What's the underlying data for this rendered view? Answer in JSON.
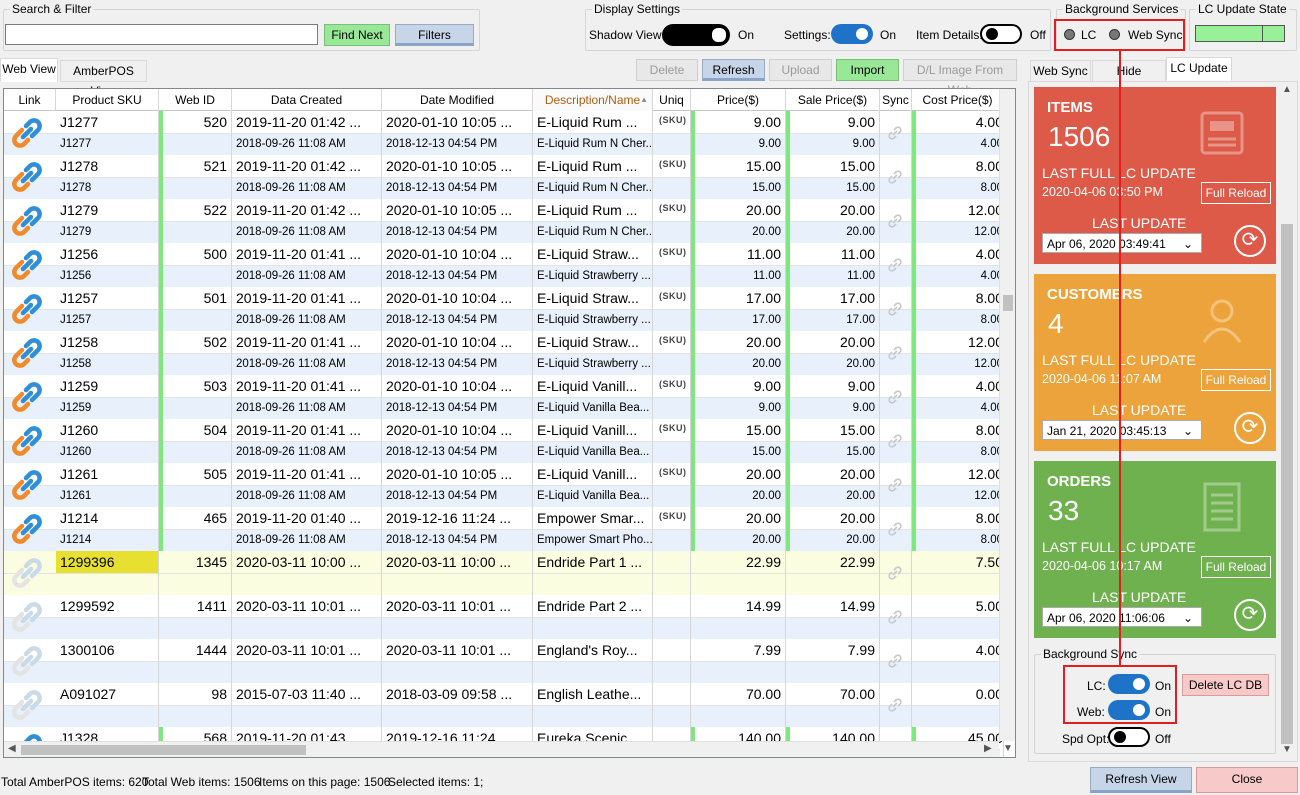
{
  "search": {
    "title": "Search & Filter",
    "value": "",
    "find_next": "Find Next",
    "filters": "Filters"
  },
  "display": {
    "title": "Display Settings",
    "shadow_view": "Shadow View:",
    "shadow_state": "On",
    "settings": "Settings:",
    "settings_state": "On",
    "item_details": "Item Details:",
    "item_details_state": "Off"
  },
  "bg_services": {
    "title": "Background Services",
    "lc": "LC",
    "web_sync": "Web Sync"
  },
  "lc_update_state": {
    "title": "LC Update State",
    "color": "#98f098"
  },
  "tabs": {
    "web_view": "Web View",
    "amberpos_view": "AmberPOS View"
  },
  "toolbar": {
    "delete": "Delete",
    "refresh": "Refresh",
    "upload": "Upload",
    "import": "Import",
    "dl_image": "D/L Image From Web"
  },
  "columns": [
    "Link",
    "Product SKU",
    "Web ID",
    "Data Created",
    "Date Modified",
    "Description/Name",
    "Uniq",
    "Price($)",
    "Sale Price($)",
    "Sync",
    "Cost Price($)"
  ],
  "sort_indicator": "▲",
  "sku_badge": "(SKU)",
  "rows": [
    {
      "sku": "J1277",
      "web_id": "520",
      "created": "2019-11-20 01:42 ...",
      "modified": "2020-01-10 10:05 ...",
      "desc": "E-Liquid Rum ...",
      "price": "9.00",
      "sale": "9.00",
      "cost": "4.00",
      "sku2": "J1277",
      "created2": "2018-09-26 11:08 AM",
      "modified2": "2018-12-13 04:54 PM",
      "desc2": "E-Liquid Rum N Cher...",
      "price2": "9.00",
      "sale2": "9.00",
      "cost2": "4.00",
      "uniq": true,
      "color": true
    },
    {
      "sku": "J1278",
      "web_id": "521",
      "created": "2019-11-20 01:42 ...",
      "modified": "2020-01-10 10:05 ...",
      "desc": "E-Liquid Rum ...",
      "price": "15.00",
      "sale": "15.00",
      "cost": "8.00",
      "sku2": "J1278",
      "created2": "2018-09-26 11:08 AM",
      "modified2": "2018-12-13 04:54 PM",
      "desc2": "E-Liquid Rum N Cher...",
      "price2": "15.00",
      "sale2": "15.00",
      "cost2": "8.00",
      "uniq": true,
      "color": true
    },
    {
      "sku": "J1279",
      "web_id": "522",
      "created": "2019-11-20 01:42 ...",
      "modified": "2020-01-10 10:05 ...",
      "desc": "E-Liquid Rum ...",
      "price": "20.00",
      "sale": "20.00",
      "cost": "12.00",
      "sku2": "J1279",
      "created2": "2018-09-26 11:08 AM",
      "modified2": "2018-12-13 04:54 PM",
      "desc2": "E-Liquid Rum N Cher...",
      "price2": "20.00",
      "sale2": "20.00",
      "cost2": "12.00",
      "uniq": true,
      "color": true
    },
    {
      "sku": "J1256",
      "web_id": "500",
      "created": "2019-11-20 01:41 ...",
      "modified": "2020-01-10 10:04 ...",
      "desc": "E-Liquid Straw...",
      "price": "11.00",
      "sale": "11.00",
      "cost": "4.00",
      "sku2": "J1256",
      "created2": "2018-09-26 11:08 AM",
      "modified2": "2018-12-13 04:54 PM",
      "desc2": "E-Liquid Strawberry ...",
      "price2": "11.00",
      "sale2": "11.00",
      "cost2": "4.00",
      "uniq": true,
      "color": true
    },
    {
      "sku": "J1257",
      "web_id": "501",
      "created": "2019-11-20 01:41 ...",
      "modified": "2020-01-10 10:04 ...",
      "desc": "E-Liquid Straw...",
      "price": "17.00",
      "sale": "17.00",
      "cost": "8.00",
      "sku2": "J1257",
      "created2": "2018-09-26 11:08 AM",
      "modified2": "2018-12-13 04:54 PM",
      "desc2": "E-Liquid Strawberry ...",
      "price2": "17.00",
      "sale2": "17.00",
      "cost2": "8.00",
      "uniq": true,
      "color": true
    },
    {
      "sku": "J1258",
      "web_id": "502",
      "created": "2019-11-20 01:41 ...",
      "modified": "2020-01-10 10:04 ...",
      "desc": "E-Liquid Straw...",
      "price": "20.00",
      "sale": "20.00",
      "cost": "12.00",
      "sku2": "J1258",
      "created2": "2018-09-26 11:08 AM",
      "modified2": "2018-12-13 04:54 PM",
      "desc2": "E-Liquid Strawberry ...",
      "price2": "20.00",
      "sale2": "20.00",
      "cost2": "12.00",
      "uniq": true,
      "color": true
    },
    {
      "sku": "J1259",
      "web_id": "503",
      "created": "2019-11-20 01:41 ...",
      "modified": "2020-01-10 10:04 ...",
      "desc": "E-Liquid Vanill...",
      "price": "9.00",
      "sale": "9.00",
      "cost": "4.00",
      "sku2": "J1259",
      "created2": "2018-09-26 11:08 AM",
      "modified2": "2018-12-13 04:54 PM",
      "desc2": "E-Liquid Vanilla Bea...",
      "price2": "9.00",
      "sale2": "9.00",
      "cost2": "4.00",
      "uniq": true,
      "color": true
    },
    {
      "sku": "J1260",
      "web_id": "504",
      "created": "2019-11-20 01:41 ...",
      "modified": "2020-01-10 10:04 ...",
      "desc": "E-Liquid Vanill...",
      "price": "15.00",
      "sale": "15.00",
      "cost": "8.00",
      "sku2": "J1260",
      "created2": "2018-09-26 11:08 AM",
      "modified2": "2018-12-13 04:54 PM",
      "desc2": "E-Liquid Vanilla Bea...",
      "price2": "15.00",
      "sale2": "15.00",
      "cost2": "8.00",
      "uniq": true,
      "color": true
    },
    {
      "sku": "J1261",
      "web_id": "505",
      "created": "2019-11-20 01:41 ...",
      "modified": "2020-01-10 10:05 ...",
      "desc": "E-Liquid Vanill...",
      "price": "20.00",
      "sale": "20.00",
      "cost": "12.00",
      "sku2": "J1261",
      "created2": "2018-09-26 11:08 AM",
      "modified2": "2018-12-13 04:54 PM",
      "desc2": "E-Liquid Vanilla Bea...",
      "price2": "20.00",
      "sale2": "20.00",
      "cost2": "12.00",
      "uniq": true,
      "color": true
    },
    {
      "sku": "J1214",
      "web_id": "465",
      "created": "2019-11-20 01:40 ...",
      "modified": "2019-12-16 11:24 ...",
      "desc": "Empower Smar...",
      "price": "20.00",
      "sale": "20.00",
      "cost": "8.00",
      "sku2": "J1214",
      "created2": "2018-09-26 11:08 AM",
      "modified2": "2018-12-13 04:54 PM",
      "desc2": "Empower Smart Pho...",
      "price2": "20.00",
      "sale2": "20.00",
      "cost2": "8.00",
      "uniq": true,
      "color": true
    },
    {
      "sku": "1299396",
      "web_id": "1345",
      "created": "2020-03-11 10:00 ...",
      "modified": "2020-03-11 10:00 ...",
      "desc": "Endride Part 1 ...",
      "price": "22.99",
      "sale": "22.99",
      "cost": "7.50",
      "sku2": "",
      "created2": "",
      "modified2": "",
      "desc2": "",
      "price2": "",
      "sale2": "",
      "cost2": "",
      "uniq": false,
      "color": false,
      "selected": true
    },
    {
      "sku": "1299592",
      "web_id": "1411",
      "created": "2020-03-11 10:01 ...",
      "modified": "2020-03-11 10:01 ...",
      "desc": "Endride Part 2 ...",
      "price": "14.99",
      "sale": "14.99",
      "cost": "5.00",
      "sku2": "",
      "created2": "",
      "modified2": "",
      "desc2": "",
      "price2": "",
      "sale2": "",
      "cost2": "",
      "uniq": false,
      "color": false
    },
    {
      "sku": "1300106",
      "web_id": "1444",
      "created": "2020-03-11 10:01 ...",
      "modified": "2020-03-11 10:01 ...",
      "desc": "England's Roy...",
      "price": "7.99",
      "sale": "7.99",
      "cost": "4.00",
      "sku2": "",
      "created2": "",
      "modified2": "",
      "desc2": "",
      "price2": "",
      "sale2": "",
      "cost2": "",
      "uniq": false,
      "color": false
    },
    {
      "sku": "A091027",
      "web_id": "98",
      "created": "2015-07-03 11:40 ...",
      "modified": "2018-03-09 09:58 ...",
      "desc": "English Leathe...",
      "price": "70.00",
      "sale": "70.00",
      "cost": "0.00",
      "sku2": "",
      "created2": "",
      "modified2": "",
      "desc2": "",
      "price2": "",
      "sale2": "",
      "cost2": "",
      "uniq": false,
      "color": false
    },
    {
      "sku": "J1328",
      "web_id": "568",
      "created": "2019-11-20 01:43 ...",
      "modified": "2019-12-16 11:24 ...",
      "desc": "Eureka Scenic ...",
      "price": "140.00",
      "sale": "140.00",
      "cost": "45.00",
      "sku2": "",
      "created2": "",
      "modified2": "",
      "desc2": "",
      "price2": "",
      "sale2": "",
      "cost2": "",
      "uniq": false,
      "color": true
    }
  ],
  "right_tabs": {
    "web_sync": "Web Sync",
    "hide_columns": "Hide Columns",
    "lc_update": "LC Update"
  },
  "cards": [
    {
      "title": "ITEMS",
      "count": "1506",
      "last_full": "LAST FULL LC UPDATE",
      "last_full_date": "2020-04-06 03:50 PM",
      "full_reload": "Full Reload",
      "last_update": "LAST UPDATE",
      "date_value": "Apr 06, 2020  03:49:41",
      "color": "#dd5a48",
      "icon": "cash-register-icon"
    },
    {
      "title": "CUSTOMERS",
      "count": "4",
      "last_full": "LAST FULL LC UPDATE",
      "last_full_date": "2020-04-06 11:07 AM",
      "full_reload": "Full Reload",
      "last_update": "LAST UPDATE",
      "date_value": "Jan 21, 2020  03:45:13",
      "color": "#eda33b",
      "icon": "person-icon"
    },
    {
      "title": "ORDERS",
      "count": "33",
      "last_full": "LAST FULL LC UPDATE",
      "last_full_date": "2020-04-06 10:17 AM",
      "full_reload": "Full Reload",
      "last_update": "LAST UPDATE",
      "date_value": "Apr 06, 2020  11:06:06",
      "color": "#6fb04f",
      "icon": "document-icon"
    }
  ],
  "bg_sync": {
    "title": "Background Sync",
    "lc": "LC:",
    "lc_state": "On",
    "web": "Web:",
    "web_state": "On",
    "spd": "Spd Opt:",
    "spd_state": "Off",
    "delete_lc_db": "Delete LC DB"
  },
  "status": {
    "total_amber": "Total AmberPOS items: 620",
    "total_web": "Total Web items: 1506",
    "on_page": "Items on this page: 1506",
    "selected": "Selected items: 1;"
  },
  "bottom": {
    "refresh_view": "Refresh View",
    "close": "Close"
  },
  "highlight_color": "#e02020"
}
